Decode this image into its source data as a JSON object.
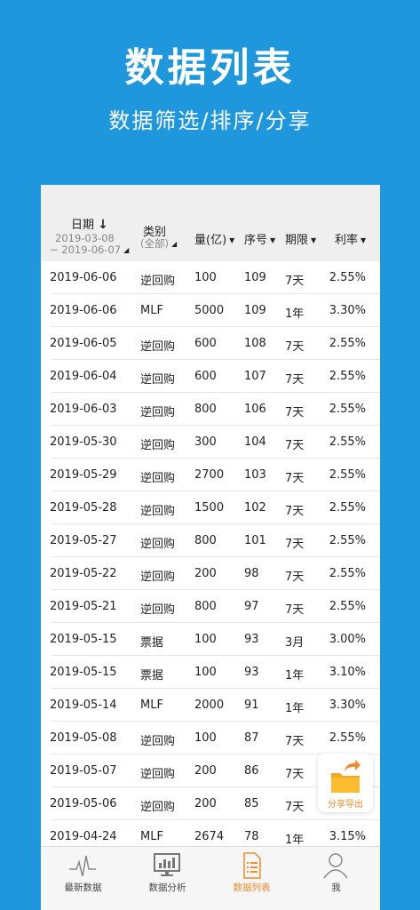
{
  "hero": {
    "title": "数据列表",
    "subtitle": "数据筛选/排序/分享"
  },
  "table": {
    "headers": {
      "date": "日期",
      "date_range_start": "2019-03-08",
      "date_range_end": "~ 2019-06-07",
      "type": "类别",
      "type_filter": "(全部)",
      "amount": "量(亿)",
      "seq": "序号",
      "term": "期限",
      "rate": "利率"
    },
    "rows": [
      {
        "date": "2019-06-06",
        "type": "逆回购",
        "amount": "100",
        "seq": "109",
        "term": "7天",
        "rate": "2.55%"
      },
      {
        "date": "2019-06-06",
        "type": "MLF",
        "amount": "5000",
        "seq": "109",
        "term": "1年",
        "rate": "3.30%"
      },
      {
        "date": "2019-06-05",
        "type": "逆回购",
        "amount": "600",
        "seq": "108",
        "term": "7天",
        "rate": "2.55%"
      },
      {
        "date": "2019-06-04",
        "type": "逆回购",
        "amount": "600",
        "seq": "107",
        "term": "7天",
        "rate": "2.55%"
      },
      {
        "date": "2019-06-03",
        "type": "逆回购",
        "amount": "800",
        "seq": "106",
        "term": "7天",
        "rate": "2.55%"
      },
      {
        "date": "2019-05-30",
        "type": "逆回购",
        "amount": "300",
        "seq": "104",
        "term": "7天",
        "rate": "2.55%"
      },
      {
        "date": "2019-05-29",
        "type": "逆回购",
        "amount": "2700",
        "seq": "103",
        "term": "7天",
        "rate": "2.55%"
      },
      {
        "date": "2019-05-28",
        "type": "逆回购",
        "amount": "1500",
        "seq": "102",
        "term": "7天",
        "rate": "2.55%"
      },
      {
        "date": "2019-05-27",
        "type": "逆回购",
        "amount": "800",
        "seq": "101",
        "term": "7天",
        "rate": "2.55%"
      },
      {
        "date": "2019-05-22",
        "type": "逆回购",
        "amount": "200",
        "seq": "98",
        "term": "7天",
        "rate": "2.55%"
      },
      {
        "date": "2019-05-21",
        "type": "逆回购",
        "amount": "800",
        "seq": "97",
        "term": "7天",
        "rate": "2.55%"
      },
      {
        "date": "2019-05-15",
        "type": "票据",
        "amount": "100",
        "seq": "93",
        "term": "3月",
        "rate": "3.00%"
      },
      {
        "date": "2019-05-15",
        "type": "票据",
        "amount": "100",
        "seq": "93",
        "term": "1年",
        "rate": "3.10%"
      },
      {
        "date": "2019-05-14",
        "type": "MLF",
        "amount": "2000",
        "seq": "91",
        "term": "1年",
        "rate": "3.30%"
      },
      {
        "date": "2019-05-08",
        "type": "逆回购",
        "amount": "100",
        "seq": "87",
        "term": "7天",
        "rate": "2.55%"
      },
      {
        "date": "2019-05-07",
        "type": "逆回购",
        "amount": "200",
        "seq": "86",
        "term": "7天",
        "rate": ""
      },
      {
        "date": "2019-05-06",
        "type": "逆回购",
        "amount": "200",
        "seq": "85",
        "term": "7天",
        "rate": ""
      },
      {
        "date": "2019-04-24",
        "type": "MLF",
        "amount": "2674",
        "seq": "78",
        "term": "1年",
        "rate": "3.15%"
      }
    ]
  },
  "fab": {
    "label": "分享导出",
    "icon": "folder-share-icon"
  },
  "tabs": [
    {
      "label": "最新数据",
      "icon": "pulse-icon"
    },
    {
      "label": "数据分析",
      "icon": "monitor-chart-icon"
    },
    {
      "label": "数据列表",
      "icon": "document-list-icon"
    },
    {
      "label": "我",
      "icon": "person-icon"
    }
  ],
  "colors": {
    "background": "#1e97dd",
    "accent": "#f08a2a",
    "header_bg": "#efefef"
  }
}
